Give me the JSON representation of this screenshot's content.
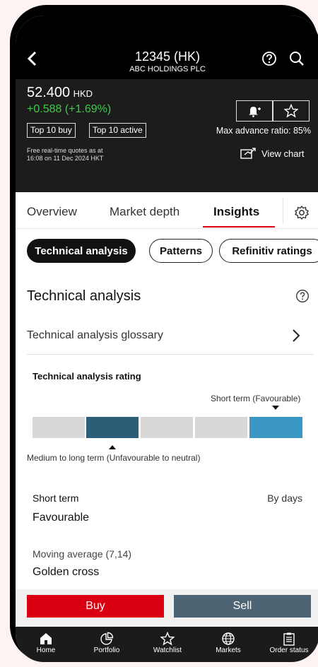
{
  "header": {
    "back_icon": "chevron-left-icon",
    "stock_code": "12345 (HK)",
    "company": "ABC HOLDINGS PLC",
    "help_icon": "question-circle-icon",
    "search_icon": "search-icon"
  },
  "quote": {
    "price": "52.400",
    "currency": "HKD",
    "change": "+0.588 (+1.69%)",
    "badges": [
      "Top 10 buy",
      "Top 10 active"
    ],
    "max_advance_ratio": "Max advance ratio: 85%",
    "disclaimer_line1": "Free real-time quotes as at",
    "disclaimer_line2": "16:08 on 11 Dec 2024 HKT",
    "view_chart": "View chart",
    "alert_icon": "bell-plus-icon",
    "favorite_icon": "star-icon",
    "change_color": "#3ec94b"
  },
  "tabs": {
    "items": [
      "Overview",
      "Market depth",
      "Insights"
    ],
    "active": "Insights",
    "settings_icon": "gear-icon",
    "active_color": "#db0011"
  },
  "subtabs": [
    "Technical analysis",
    "Patterns",
    "Refinitiv ratings"
  ],
  "section": {
    "title": "Technical analysis",
    "glossary": "Technical analysis glossary",
    "rating_title": "Technical analysis rating",
    "short_term_label": "Short term (Favourable)",
    "medium_term_label": "Medium to long term (Unfavourable to neutral)",
    "short_term_heading": "Short term",
    "by_days": "By days",
    "short_term_value": "Favourable",
    "moving_average_label": "Moving average (7,14)",
    "moving_average_value": "Golden cross"
  },
  "rating_scale": {
    "segments": 5,
    "medium_long_term_index": 1,
    "short_term_index": 4
  },
  "actions": {
    "buy": "Buy",
    "sell": "Sell",
    "buy_color": "#db0011",
    "sell_color": "#4d6474"
  },
  "bottom_nav": [
    {
      "label": "Home",
      "icon": "home-icon"
    },
    {
      "label": "Portfolio",
      "icon": "pie-chart-icon"
    },
    {
      "label": "Watchlist",
      "icon": "star-icon"
    },
    {
      "label": "Markets",
      "icon": "globe-icon"
    },
    {
      "label": "Order status",
      "icon": "clipboard-icon"
    }
  ]
}
